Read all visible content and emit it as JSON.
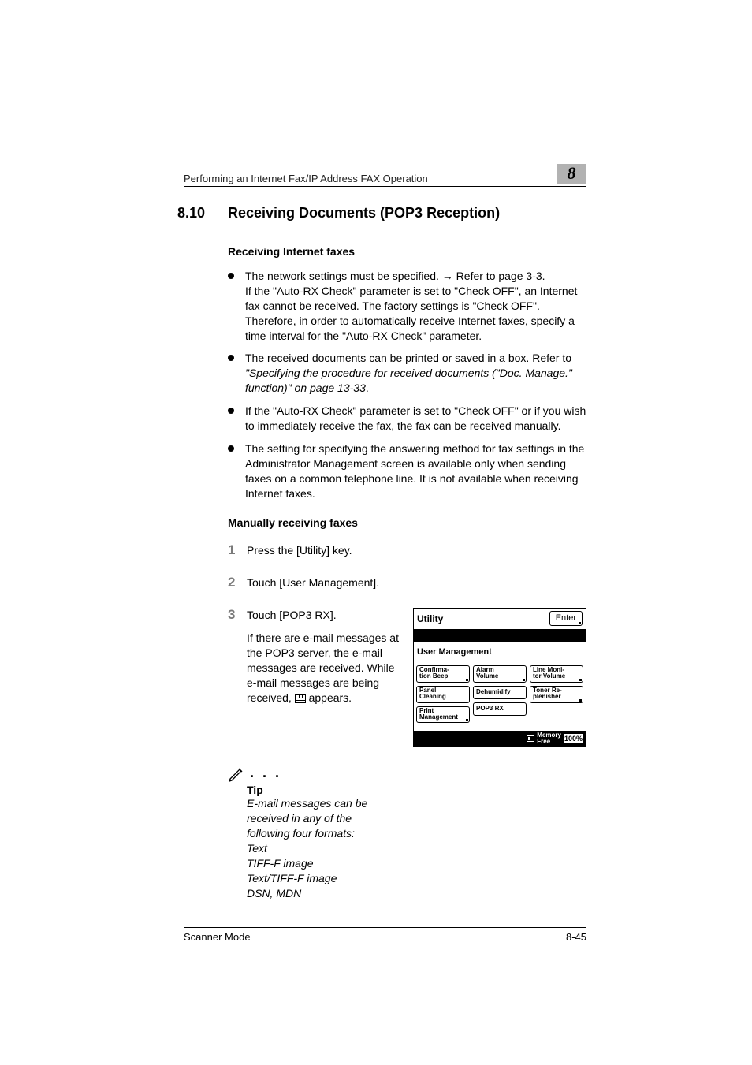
{
  "header": {
    "running_title": "Performing an Internet Fax/IP Address FAX Operation",
    "chapter_number": "8"
  },
  "section": {
    "number": "8.10",
    "title": "Receiving Documents (POP3 Reception)",
    "subheading1": "Receiving Internet faxes",
    "bullets": [
      {
        "line1": "The network settings must be specified. → Refer to page 3-3.",
        "rest": "If the \"Auto-RX Check\" parameter is set to \"Check OFF\", an Internet fax cannot be received. The factory settings is \"Check OFF\". Therefore, in order to automatically receive Internet faxes, specify a time interval for the \"Auto-RX Check\" parameter."
      },
      {
        "line1": "The received documents can be printed or saved in a box. Refer to ",
        "italic": "\"Specifying the procedure for received documents (\"Doc. Manage.\" function)\" on page 13-33",
        "tail": "."
      },
      {
        "line1": "If the \"Auto-RX Check\" parameter is set to \"Check OFF\" or if you wish to immediately receive the fax, the fax can be received manually."
      },
      {
        "line1": "The setting for specifying the answering method for fax settings in the Administrator Management screen is available only when sending faxes on a common telephone line. It is not available when receiving Internet faxes."
      }
    ],
    "subheading2": "Manually receiving faxes",
    "steps": {
      "s1": "Press the [Utility] key.",
      "s2": "Touch [User Management].",
      "s3_head": "Touch [POP3 RX].",
      "s3_body_a": "If there are e-mail messages at the POP3 server, the e-mail messages are received. While e-mail messages are being received, ",
      "s3_body_b": " appears."
    },
    "tip": {
      "label": "Tip",
      "body": "E-mail messages can be received in any of the following four formats:\nText\nTIFF-F image\nText/TIFF-F image\nDSN, MDN"
    }
  },
  "lcd": {
    "title": "Utility",
    "enter": "Enter",
    "sublabel": "User Management",
    "col1": [
      "Confirma-\ntion Beep",
      "Panel\nCleaning",
      "Print\nManagement"
    ],
    "col2": [
      "Alarm\nVolume",
      "Dehumidify",
      "POP3 RX"
    ],
    "col3": [
      "Line Moni-\ntor Volume",
      "Toner Re-\nplenisher"
    ],
    "memory_label": "Memory\nFree",
    "memory_pct": "100%"
  },
  "footer": {
    "left": "Scanner Mode",
    "right": "8-45"
  }
}
